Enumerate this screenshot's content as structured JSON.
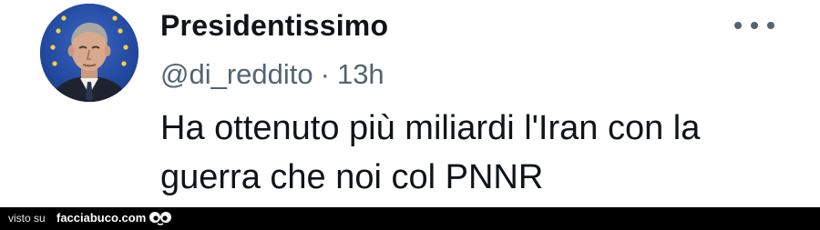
{
  "tweet": {
    "display_name": "Presidentissimo",
    "handle": "@di_reddito",
    "separator": "·",
    "time": "13h",
    "text": "Ha ottenuto più miliardi l'Iran con la guerra che noi col PNNR",
    "icons": {
      "avatar": "profile-photo",
      "more": "more-options-icon"
    }
  },
  "footer": {
    "visto_label": "visto su",
    "site_label": "facciabuco.com",
    "logo_icon": "eyes-logo-icon"
  },
  "colors": {
    "text_primary": "#0f1419",
    "text_secondary": "#536471",
    "avatar_background": "#1d3f9a",
    "footer_background": "#000000"
  }
}
